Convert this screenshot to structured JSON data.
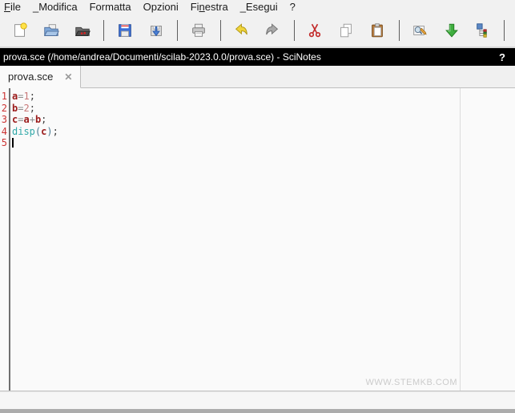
{
  "title_bar": {
    "title": "prova.sce (/home/andrea/Documenti/scilab-2023.0.0/prova.sce) - SciNotes",
    "help_glyph": "?"
  },
  "menubar": {
    "items": [
      {
        "label": "File",
        "underline": 0
      },
      {
        "label": "_Modifica",
        "underline": -1
      },
      {
        "label": "Formatta",
        "underline": -1
      },
      {
        "label": "Opzioni",
        "underline": -1
      },
      {
        "label": "Finestra",
        "underline": 2
      },
      {
        "label": "_Esegui",
        "underline": -1
      },
      {
        "label": "?",
        "underline": -1
      }
    ]
  },
  "toolbar": {
    "items": [
      {
        "name": "new-file"
      },
      {
        "name": "open-file"
      },
      {
        "name": "open-file-in"
      },
      {
        "sep": true
      },
      {
        "name": "save"
      },
      {
        "name": "save-as"
      },
      {
        "sep": true
      },
      {
        "name": "print"
      },
      {
        "sep": true
      },
      {
        "name": "undo"
      },
      {
        "name": "redo"
      },
      {
        "sep": true
      },
      {
        "name": "cut"
      },
      {
        "name": "copy"
      },
      {
        "name": "paste"
      },
      {
        "sep": true
      },
      {
        "name": "search-replace"
      },
      {
        "name": "save-and-execute"
      },
      {
        "name": "code-navigator"
      },
      {
        "sep": true
      }
    ]
  },
  "tabs": [
    {
      "label": "prova.sce",
      "close_glyph": "✕",
      "selected": true
    }
  ],
  "editor": {
    "lines": [
      {
        "number": "1",
        "tokens": [
          {
            "t": "var",
            "s": "a"
          },
          {
            "t": "op",
            "s": "="
          },
          {
            "t": "num",
            "s": "1"
          },
          {
            "t": "punc",
            "s": ";"
          }
        ]
      },
      {
        "number": "2",
        "tokens": [
          {
            "t": "var",
            "s": "b"
          },
          {
            "t": "op",
            "s": "="
          },
          {
            "t": "num",
            "s": "2"
          },
          {
            "t": "punc",
            "s": ";"
          }
        ]
      },
      {
        "number": "3",
        "tokens": [
          {
            "t": "var",
            "s": "c"
          },
          {
            "t": "op",
            "s": "="
          },
          {
            "t": "var",
            "s": "a"
          },
          {
            "t": "op",
            "s": "+"
          },
          {
            "t": "var",
            "s": "b"
          },
          {
            "t": "punc",
            "s": ";"
          }
        ]
      },
      {
        "number": "4",
        "tokens": [
          {
            "t": "fn",
            "s": "disp"
          },
          {
            "t": "paren",
            "s": "("
          },
          {
            "t": "var",
            "s": "c"
          },
          {
            "t": "paren",
            "s": ")"
          },
          {
            "t": "punc",
            "s": ";"
          }
        ]
      },
      {
        "number": "5",
        "tokens": [],
        "cursor": true
      }
    ],
    "watermark": "WWW.STEMKB.COM",
    "colors": {
      "line_number": "#CC3333",
      "variable": "#9B1B1B",
      "operator": "#8C8C8C",
      "number": "#C87878",
      "punctuation": "#3C3C3C",
      "function": "#2FA8A8",
      "paren": "#4C7C94",
      "titlebar_bg": "#000000",
      "titlebar_fg": "#FFFFFF"
    }
  }
}
